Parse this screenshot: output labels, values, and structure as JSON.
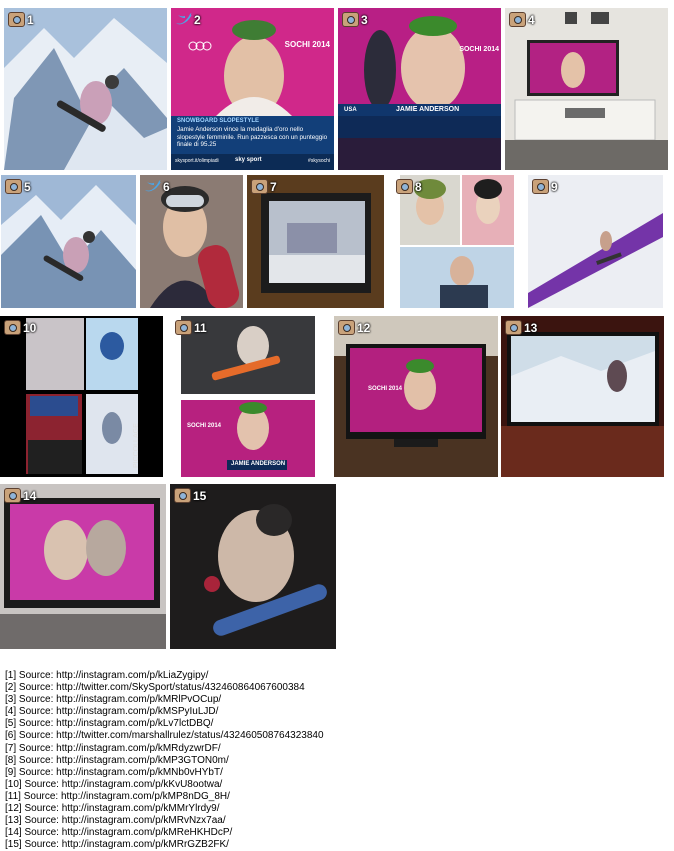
{
  "tiles": [
    {
      "num": "1",
      "source": "instagram"
    },
    {
      "num": "2",
      "source": "twitter",
      "caption_tag": "SNOWBOARD SLOPESTYLE",
      "caption_text": "Jamie Anderson vince la medaglia d'oro nello slopestyle femminile. Run pazzesca con un punteggio finale di 95.25",
      "footer_left": "skysport.it/olimpiadi",
      "footer_mid": "sky sport",
      "footer_right": "#skysochi",
      "banner": "SOCHI 2014"
    },
    {
      "num": "3",
      "source": "instagram",
      "name_bar": "JAMIE ANDERSON",
      "country": "USA",
      "banner": "SOCHI 2014"
    },
    {
      "num": "4",
      "source": "instagram"
    },
    {
      "num": "5",
      "source": "instagram"
    },
    {
      "num": "6",
      "source": "twitter"
    },
    {
      "num": "7",
      "source": "instagram"
    },
    {
      "num": "8",
      "source": "instagram"
    },
    {
      "num": "9",
      "source": "instagram"
    },
    {
      "num": "10",
      "source": "instagram",
      "side_text": "PICCOLLAGE"
    },
    {
      "num": "11",
      "source": "instagram",
      "banner": "SOCHI 2014",
      "name_bar": "JAMIE ANDERSON"
    },
    {
      "num": "12",
      "source": "instagram",
      "banner": "SOCHI 2014"
    },
    {
      "num": "13",
      "source": "instagram"
    },
    {
      "num": "14",
      "source": "instagram"
    },
    {
      "num": "15",
      "source": "instagram"
    }
  ],
  "sources": [
    "[1] Source: http://instagram.com/p/kLiaZygipy/",
    "[2] Source: http://twitter.com/SkySport/status/432460864067600384",
    "[3] Source: http://instagram.com/p/kMRlPvOCup/",
    "[4] Source: http://instagram.com/p/kMSPyIuLJD/",
    "[5] Source: http://instagram.com/p/kLv7lctDBQ/",
    "[6] Source: http://twitter.com/marshallrulez/status/432460508764323840",
    "[7] Source: http://instagram.com/p/kMRdyzwrDF/",
    "[8] Source: http://instagram.com/p/kMP3GTON0m/",
    "[9] Source: http://instagram.com/p/kMNb0vHYbT/",
    "[10] Source: http://instagram.com/p/kKvU8ootwa/",
    "[11] Source: http://instagram.com/p/kMP8nDG_8H/",
    "[12] Source: http://instagram.com/p/kMMrYlrdy9/",
    "[13] Source: http://instagram.com/p/kMRvNzx7aa/",
    "[14] Source: http://instagram.com/p/kMReHKHDcP/",
    "[15] Source: http://instagram.com/p/kMRrGZB2FK/"
  ]
}
